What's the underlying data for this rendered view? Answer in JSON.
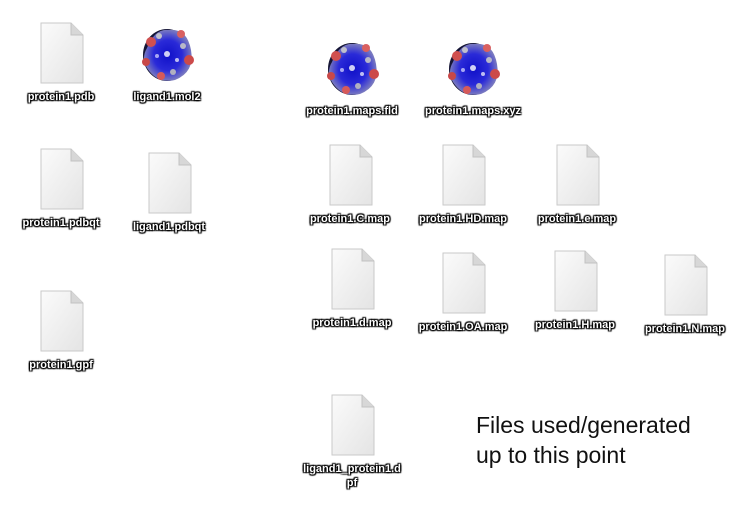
{
  "files": [
    {
      "name": "protein1.pdb",
      "icon": "document-icon"
    },
    {
      "name": "ligand1.mol2",
      "icon": "molecule-icon"
    },
    {
      "name": "protein1.pdbqt",
      "icon": "document-icon"
    },
    {
      "name": "ligand1.pdbqt",
      "icon": "document-icon"
    },
    {
      "name": "protein1.gpf",
      "icon": "document-icon"
    },
    {
      "name": "protein1.maps.fld",
      "icon": "molecule-icon"
    },
    {
      "name": "protein1.maps.xyz",
      "icon": "molecule-icon"
    },
    {
      "name": "protein1.C.map",
      "icon": "document-icon"
    },
    {
      "name": "protein1.HD.map",
      "icon": "document-icon"
    },
    {
      "name": "protein1.e.map",
      "icon": "document-icon"
    },
    {
      "name": "protein1.d.map",
      "icon": "document-icon"
    },
    {
      "name": "protein1.OA.map",
      "icon": "document-icon"
    },
    {
      "name": "protein1.H.map",
      "icon": "document-icon"
    },
    {
      "name": "protein1.N.map",
      "icon": "document-icon"
    },
    {
      "name": "ligand1_protein1.dpf",
      "icon": "document-icon"
    }
  ],
  "note": {
    "line1": "Files used/generated",
    "line2": "up to this point"
  }
}
